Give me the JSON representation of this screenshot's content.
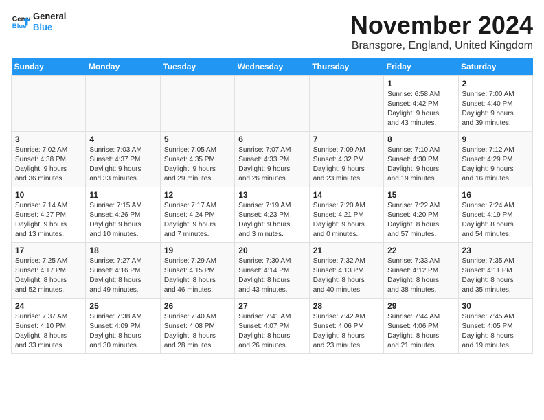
{
  "logo": {
    "line1": "General",
    "line2": "Blue"
  },
  "title": "November 2024",
  "location": "Bransgore, England, United Kingdom",
  "days_of_week": [
    "Sunday",
    "Monday",
    "Tuesday",
    "Wednesday",
    "Thursday",
    "Friday",
    "Saturday"
  ],
  "weeks": [
    [
      {
        "day": "",
        "info": ""
      },
      {
        "day": "",
        "info": ""
      },
      {
        "day": "",
        "info": ""
      },
      {
        "day": "",
        "info": ""
      },
      {
        "day": "",
        "info": ""
      },
      {
        "day": "1",
        "info": "Sunrise: 6:58 AM\nSunset: 4:42 PM\nDaylight: 9 hours\nand 43 minutes."
      },
      {
        "day": "2",
        "info": "Sunrise: 7:00 AM\nSunset: 4:40 PM\nDaylight: 9 hours\nand 39 minutes."
      }
    ],
    [
      {
        "day": "3",
        "info": "Sunrise: 7:02 AM\nSunset: 4:38 PM\nDaylight: 9 hours\nand 36 minutes."
      },
      {
        "day": "4",
        "info": "Sunrise: 7:03 AM\nSunset: 4:37 PM\nDaylight: 9 hours\nand 33 minutes."
      },
      {
        "day": "5",
        "info": "Sunrise: 7:05 AM\nSunset: 4:35 PM\nDaylight: 9 hours\nand 29 minutes."
      },
      {
        "day": "6",
        "info": "Sunrise: 7:07 AM\nSunset: 4:33 PM\nDaylight: 9 hours\nand 26 minutes."
      },
      {
        "day": "7",
        "info": "Sunrise: 7:09 AM\nSunset: 4:32 PM\nDaylight: 9 hours\nand 23 minutes."
      },
      {
        "day": "8",
        "info": "Sunrise: 7:10 AM\nSunset: 4:30 PM\nDaylight: 9 hours\nand 19 minutes."
      },
      {
        "day": "9",
        "info": "Sunrise: 7:12 AM\nSunset: 4:29 PM\nDaylight: 9 hours\nand 16 minutes."
      }
    ],
    [
      {
        "day": "10",
        "info": "Sunrise: 7:14 AM\nSunset: 4:27 PM\nDaylight: 9 hours\nand 13 minutes."
      },
      {
        "day": "11",
        "info": "Sunrise: 7:15 AM\nSunset: 4:26 PM\nDaylight: 9 hours\nand 10 minutes."
      },
      {
        "day": "12",
        "info": "Sunrise: 7:17 AM\nSunset: 4:24 PM\nDaylight: 9 hours\nand 7 minutes."
      },
      {
        "day": "13",
        "info": "Sunrise: 7:19 AM\nSunset: 4:23 PM\nDaylight: 9 hours\nand 3 minutes."
      },
      {
        "day": "14",
        "info": "Sunrise: 7:20 AM\nSunset: 4:21 PM\nDaylight: 9 hours\nand 0 minutes."
      },
      {
        "day": "15",
        "info": "Sunrise: 7:22 AM\nSunset: 4:20 PM\nDaylight: 8 hours\nand 57 minutes."
      },
      {
        "day": "16",
        "info": "Sunrise: 7:24 AM\nSunset: 4:19 PM\nDaylight: 8 hours\nand 54 minutes."
      }
    ],
    [
      {
        "day": "17",
        "info": "Sunrise: 7:25 AM\nSunset: 4:17 PM\nDaylight: 8 hours\nand 52 minutes."
      },
      {
        "day": "18",
        "info": "Sunrise: 7:27 AM\nSunset: 4:16 PM\nDaylight: 8 hours\nand 49 minutes."
      },
      {
        "day": "19",
        "info": "Sunrise: 7:29 AM\nSunset: 4:15 PM\nDaylight: 8 hours\nand 46 minutes."
      },
      {
        "day": "20",
        "info": "Sunrise: 7:30 AM\nSunset: 4:14 PM\nDaylight: 8 hours\nand 43 minutes."
      },
      {
        "day": "21",
        "info": "Sunrise: 7:32 AM\nSunset: 4:13 PM\nDaylight: 8 hours\nand 40 minutes."
      },
      {
        "day": "22",
        "info": "Sunrise: 7:33 AM\nSunset: 4:12 PM\nDaylight: 8 hours\nand 38 minutes."
      },
      {
        "day": "23",
        "info": "Sunrise: 7:35 AM\nSunset: 4:11 PM\nDaylight: 8 hours\nand 35 minutes."
      }
    ],
    [
      {
        "day": "24",
        "info": "Sunrise: 7:37 AM\nSunset: 4:10 PM\nDaylight: 8 hours\nand 33 minutes."
      },
      {
        "day": "25",
        "info": "Sunrise: 7:38 AM\nSunset: 4:09 PM\nDaylight: 8 hours\nand 30 minutes."
      },
      {
        "day": "26",
        "info": "Sunrise: 7:40 AM\nSunset: 4:08 PM\nDaylight: 8 hours\nand 28 minutes."
      },
      {
        "day": "27",
        "info": "Sunrise: 7:41 AM\nSunset: 4:07 PM\nDaylight: 8 hours\nand 26 minutes."
      },
      {
        "day": "28",
        "info": "Sunrise: 7:42 AM\nSunset: 4:06 PM\nDaylight: 8 hours\nand 23 minutes."
      },
      {
        "day": "29",
        "info": "Sunrise: 7:44 AM\nSunset: 4:06 PM\nDaylight: 8 hours\nand 21 minutes."
      },
      {
        "day": "30",
        "info": "Sunrise: 7:45 AM\nSunset: 4:05 PM\nDaylight: 8 hours\nand 19 minutes."
      }
    ]
  ]
}
